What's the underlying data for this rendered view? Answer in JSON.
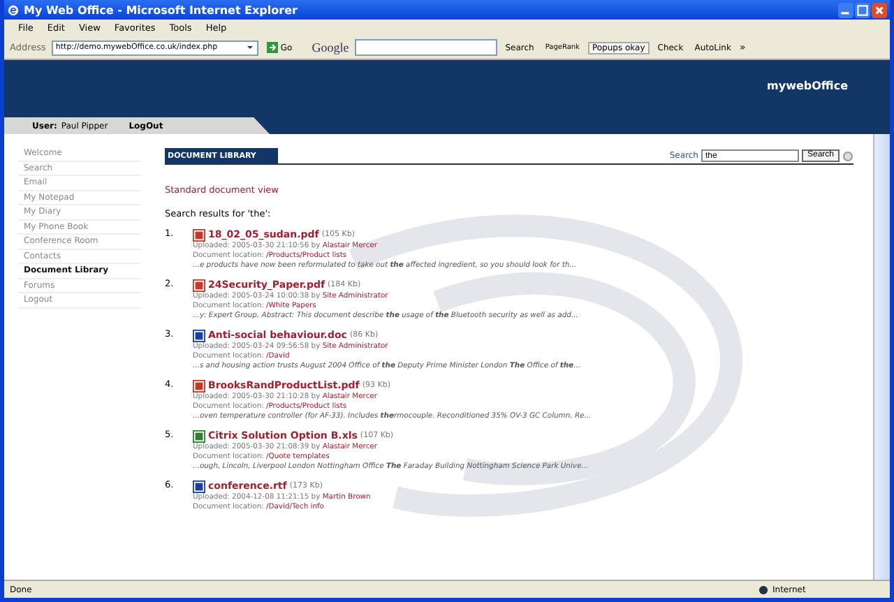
{
  "window": {
    "title": "My Web Office - Microsoft Internet Explorer"
  },
  "menu": [
    "File",
    "Edit",
    "View",
    "Favorites",
    "Tools",
    "Help"
  ],
  "address_bar": {
    "label": "Address",
    "url": "http://demo.mywebOffice.co.uk/index.php",
    "go": "Go"
  },
  "google_toolbar": {
    "brand": "Google",
    "search": "Search",
    "pagerank": "PageRank",
    "popups": "Popups okay",
    "check": "Check",
    "autolink": "AutoLink",
    "more": "»"
  },
  "site": {
    "logo": "mywebOffice",
    "user_label": "User:",
    "user_name": "Paul Pipper",
    "logout": "LogOut"
  },
  "sidebar": {
    "items": [
      {
        "label": "Welcome",
        "selected": false
      },
      {
        "label": "Search",
        "selected": false
      },
      {
        "label": "Email",
        "selected": false
      },
      {
        "label": "My Notepad",
        "selected": false
      },
      {
        "label": "My Diary",
        "selected": false
      },
      {
        "label": "My Phone Book",
        "selected": false
      },
      {
        "label": "Conference Room",
        "selected": false
      },
      {
        "label": "Contacts",
        "selected": false
      },
      {
        "label": "Document Library",
        "selected": true
      },
      {
        "label": "Forums",
        "selected": false
      },
      {
        "label": "Logout",
        "selected": false
      }
    ]
  },
  "library": {
    "title": "DOCUMENT LIBRARY",
    "search_label": "Search",
    "search_value": "the",
    "search_button": "Search",
    "view_link": "Standard document view",
    "results_heading": "Search results for 'the':"
  },
  "results": [
    {
      "number": "1.",
      "kind": "pdf",
      "name": "18_02_05_sudan.pdf",
      "size": "(105 Kb)",
      "uploaded": "Uploaded: 2005-03-30 21:10:56 by",
      "uploader": "Alastair Mercer",
      "location_label": "Document location:",
      "location": "/Products/Product lists",
      "snippet": "...e products have now been reformulated to take out **the** affected ingredient, so you should look for th..."
    },
    {
      "number": "2.",
      "kind": "pdf",
      "name": "24Security_Paper.pdf",
      "size": "(184 Kb)",
      "uploaded": "Uploaded: 2005-03-24 10:00:38 by",
      "uploader": "Site Administrator",
      "location_label": "Document location:",
      "location": "/White Papers",
      "snippet": "...y: Expert Group, Abstract: This document describe **the** usage of **the** Bluetooth security as well as add..."
    },
    {
      "number": "3.",
      "kind": "doc",
      "name": "Anti-social behaviour.doc",
      "size": "(86 Kb)",
      "uploaded": "Uploaded: 2005-03-24 09:56:58 by",
      "uploader": "Site Administrator",
      "location_label": "Document location:",
      "location": "/David",
      "snippet": "...s and housing action trusts August 2004 Office of **the** Deputy Prime Minister London **The** Office of **the**..."
    },
    {
      "number": "4.",
      "kind": "pdf",
      "name": "BrooksRandProductList.pdf",
      "size": "(93 Kb)",
      "uploaded": "Uploaded: 2005-03-30 21:10:28 by",
      "uploader": "Alastair Mercer",
      "location_label": "Document location:",
      "location": "/Products/Product lists",
      "snippet": "...oven temperature controller (for AF-33). Includes **the**rmocouple. Reconditioned 35% OV-3 GC Column. Re..."
    },
    {
      "number": "5.",
      "kind": "xls",
      "name": "Citrix Solution Option B.xls",
      "size": "(107 Kb)",
      "uploaded": "Uploaded: 2005-03-30 21:08:39 by",
      "uploader": "Alastair Mercer",
      "location_label": "Document location:",
      "location": "/Quote templates",
      "snippet": "...ough, Lincoln, Liverpool London Nottingham Office **The** Faraday Building Nottingham Science Park Unive..."
    },
    {
      "number": "6.",
      "kind": "doc",
      "name": "conference.rtf",
      "size": "(173 Kb)",
      "uploaded": "Uploaded: 2004-12-08 11:21:15 by",
      "uploader": "Martin Brown",
      "location_label": "Document location:",
      "location": "/David/Tech info"
    }
  ],
  "status_bar": {
    "text": "Done",
    "zone": "Internet"
  }
}
